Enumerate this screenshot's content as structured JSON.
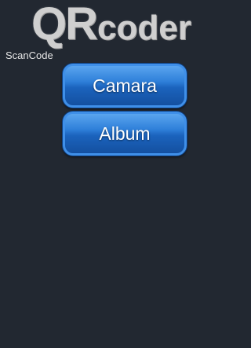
{
  "app": {
    "logo_qr": "QR",
    "logo_coder": "coder",
    "screen_label": "ScanCode"
  },
  "actions": {
    "camera_label": "Camara",
    "album_label": "Album"
  },
  "colors": {
    "background": "#222831",
    "button_blue": "#1b63bd",
    "logo_gray": "#cfcfcf"
  }
}
